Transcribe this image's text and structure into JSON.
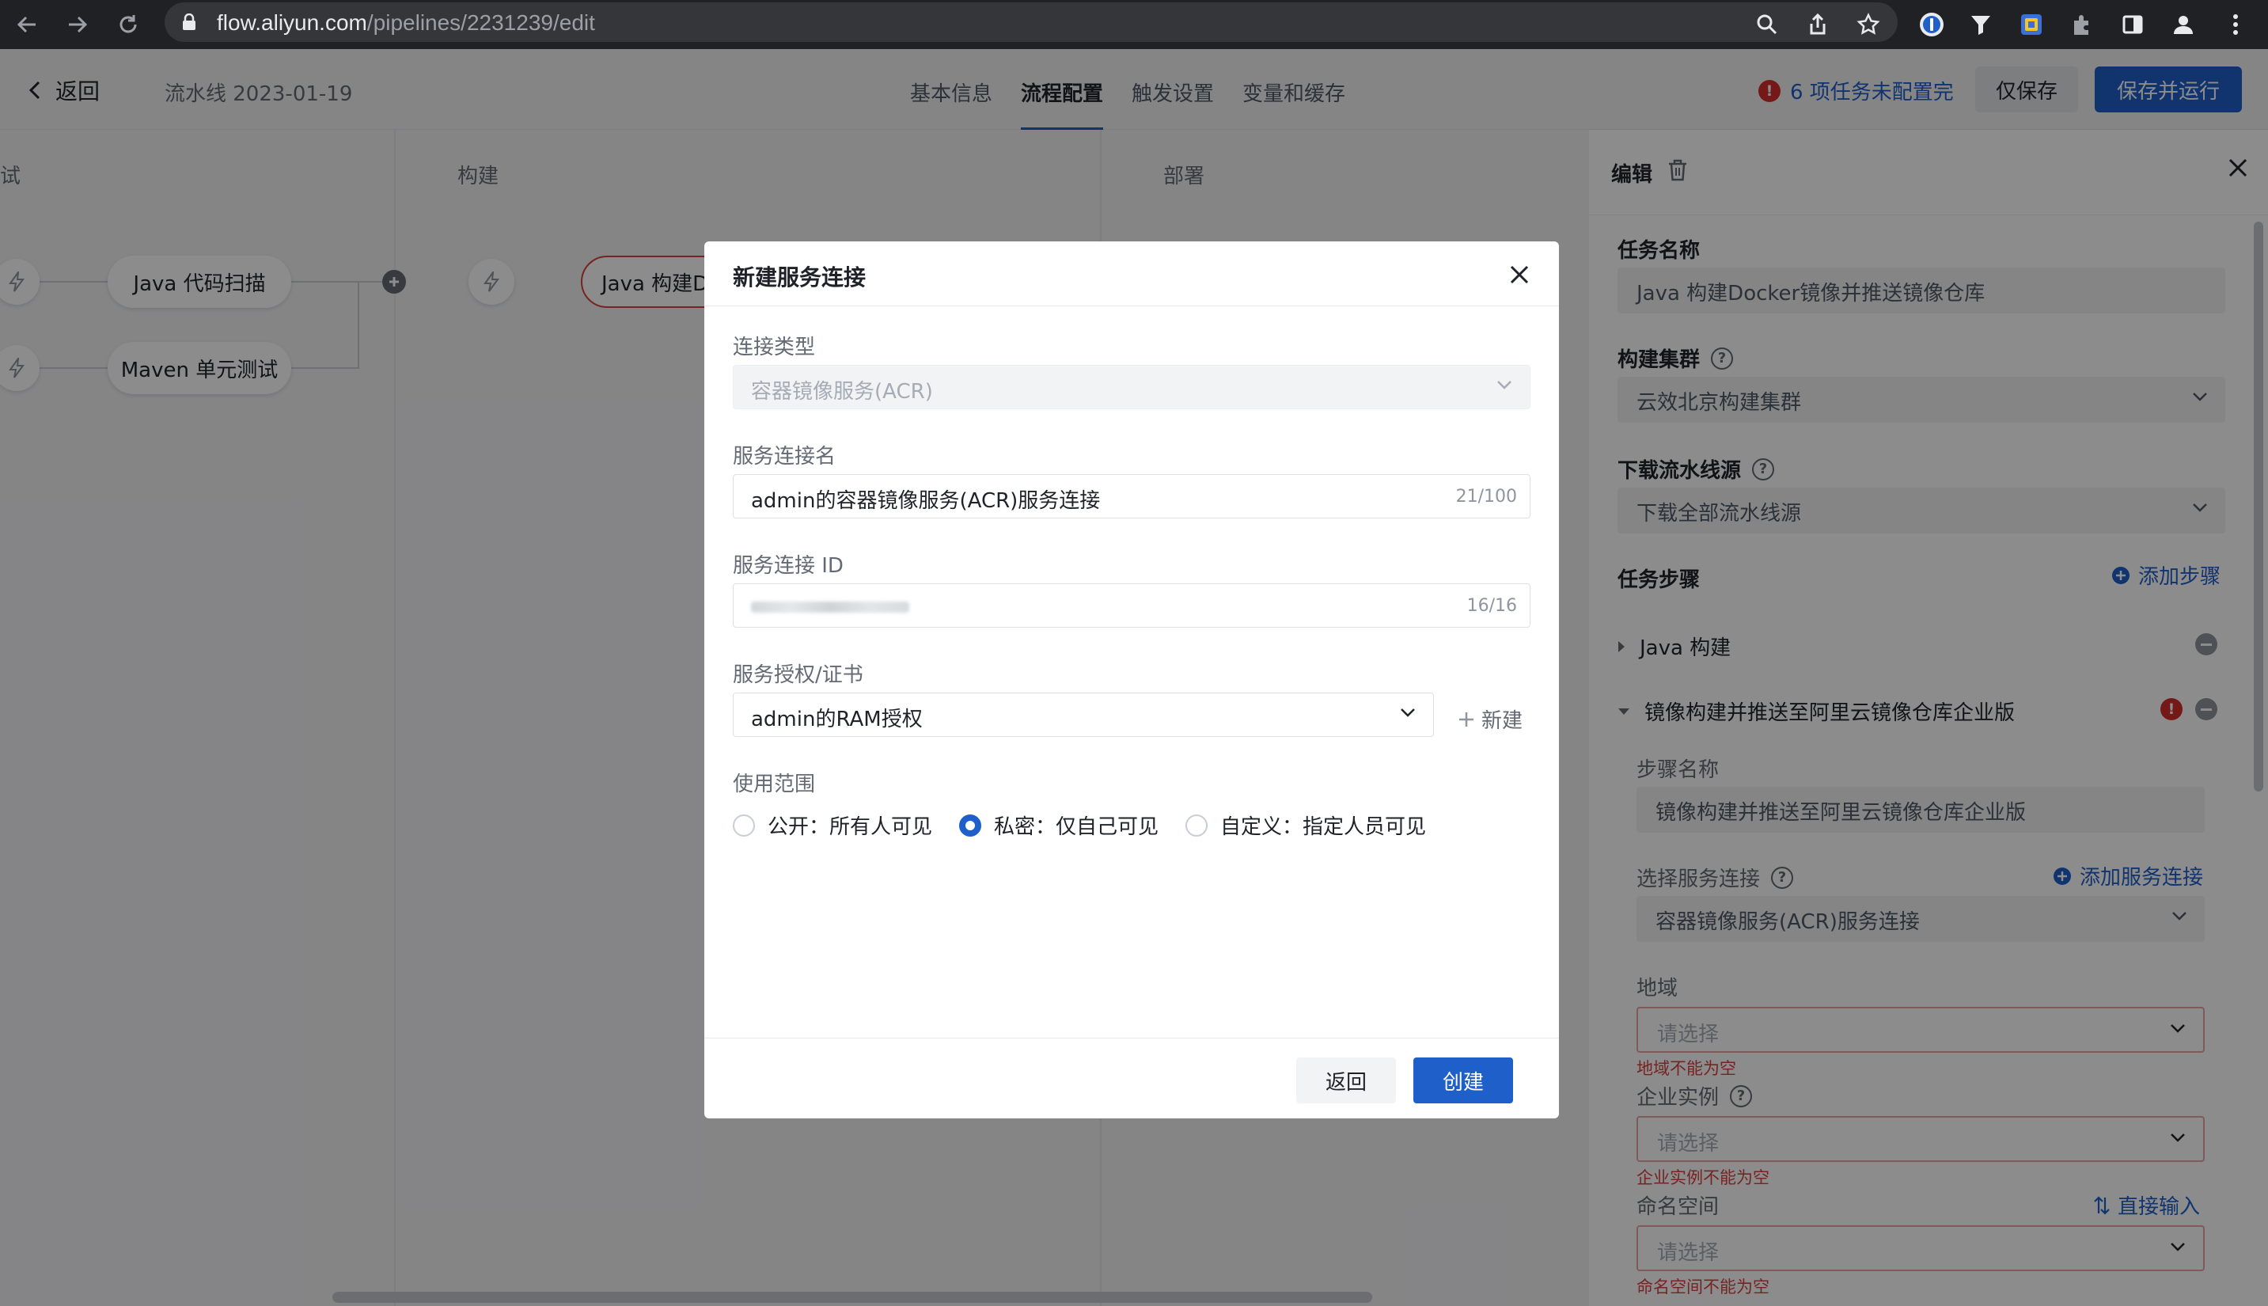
{
  "browser": {
    "url_host": "flow.aliyun.com",
    "url_path": "/pipelines/2231239/edit"
  },
  "header": {
    "back_label": "返回",
    "pipeline_name": "流水线 2023-01-19",
    "tabs": [
      "基本信息",
      "流程配置",
      "触发设置",
      "变量和缓存"
    ],
    "active_tab": "流程配置",
    "warning_text": "6 项任务未配置完",
    "save_only_label": "仅保存",
    "save_run_label": "保存并运行"
  },
  "canvas": {
    "stages": [
      "试",
      "构建",
      "部署"
    ],
    "jobs": {
      "code_scan": "Java 代码扫描",
      "unit_test": "Maven 单元测试",
      "build_job": "Java 构建Do"
    }
  },
  "modal": {
    "title": "新建服务连接",
    "connection_type_label": "连接类型",
    "connection_type_value": "容器镜像服务(ACR)",
    "name_label": "服务连接名",
    "name_value": "admin的容器镜像服务(ACR)服务连接",
    "name_count": "21/100",
    "id_label": "服务连接 ID",
    "id_count": "16/16",
    "auth_label": "服务授权/证书",
    "auth_value": "admin的RAM授权",
    "new_label": "新建",
    "scope_label": "使用范围",
    "scope_options": [
      {
        "label": "公开：所有人可见",
        "selected": false
      },
      {
        "label": "私密：仅自己可见",
        "selected": true
      },
      {
        "label": "自定义：指定人员可见",
        "selected": false
      }
    ],
    "back_button": "返回",
    "create_button": "创建"
  },
  "panel": {
    "title": "编辑",
    "task_name_label": "任务名称",
    "task_name_value": "Java 构建Docker镜像并推送镜像仓库",
    "cluster_label": "构建集群",
    "cluster_value": "云效北京构建集群",
    "download_label": "下载流水线源",
    "download_value": "下载全部流水线源",
    "steps_label": "任务步骤",
    "add_step_label": "添加步骤",
    "step1": "Java 构建",
    "step2": "镜像构建并推送至阿里云镜像仓库企业版",
    "step_name_label": "步骤名称",
    "step_name_value": "镜像构建并推送至阿里云镜像仓库企业版",
    "service_conn_label": "选择服务连接",
    "add_service_conn_label": "添加服务连接",
    "service_conn_value": "容器镜像服务(ACR)服务连接",
    "region_label": "地域",
    "region_placeholder": "请选择",
    "region_error": "地域不能为空",
    "instance_label": "企业实例",
    "instance_placeholder": "请选择",
    "instance_error": "企业实例不能为空",
    "namespace_label": "命名空间",
    "direct_input_label": "直接输入",
    "namespace_placeholder": "请选择",
    "namespace_error": "命名空间不能为空"
  },
  "colors": {
    "primary": "#1f5fc9",
    "error": "#d94040"
  }
}
